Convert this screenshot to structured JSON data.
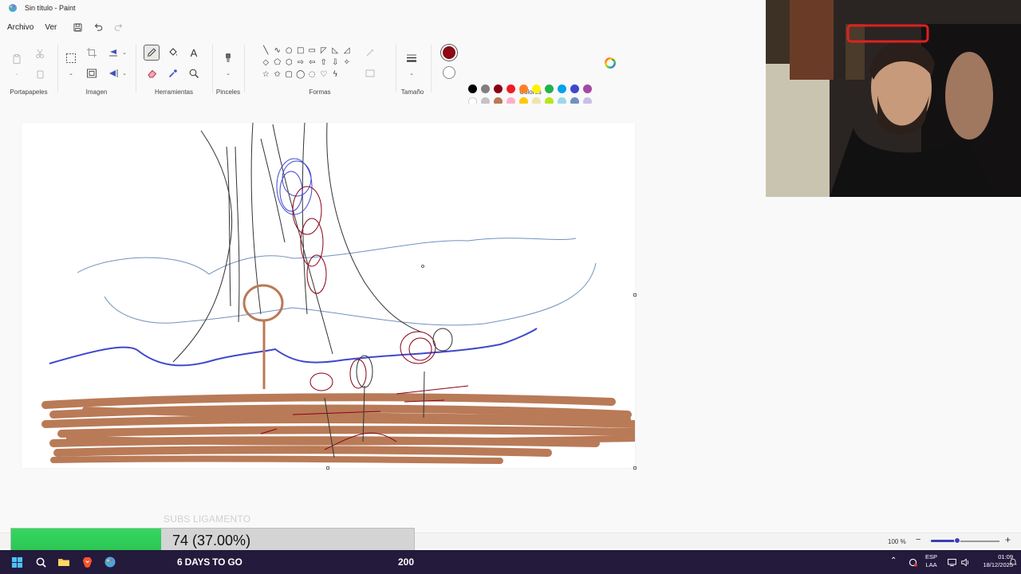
{
  "window": {
    "title": "Sin título - Paint"
  },
  "menu": {
    "file": "Archivo",
    "view": "Ver"
  },
  "ribbon": {
    "groups": {
      "clipboard": "Portapapeles",
      "image": "Imagen",
      "tools": "Herramientas",
      "brushes": "Pinceles",
      "shapes": "Formas",
      "size": "Tamaño",
      "colors": "Colores"
    },
    "text_tool": "A",
    "shape_glyphs": [
      "╲",
      "∿",
      "○",
      "□",
      "▭",
      "◸",
      "◺",
      "◿",
      "◇",
      "⬠",
      "⬡",
      "⇨",
      "⇦",
      "⇧",
      "⇩",
      "✧",
      "☆",
      "✩",
      "▢",
      "◯",
      "◌",
      "♡",
      "ϟ",
      ""
    ],
    "palette_row1": [
      "#000000",
      "#7f7f7f",
      "#880015",
      "#ed1c24",
      "#ff7f27",
      "#fff200",
      "#22b14c",
      "#00a2e8",
      "#3f48cc",
      "#a349a4"
    ],
    "palette_row2": [
      "#ffffff",
      "#c3c3c3",
      "#b97a57",
      "#ffaec9",
      "#ffc90e",
      "#efe4b0",
      "#b5e61d",
      "#99d9ea",
      "#7092be",
      "#c8bfe7"
    ],
    "primary_color": "#8b0a14",
    "secondary_color": "#ffffff"
  },
  "overlay": {
    "subs_label": "SUBS LIGAMENTO"
  },
  "status": {
    "zoom": "100 %",
    "zoom_level": 0.38
  },
  "goal": {
    "text": "74 (37.00%)",
    "progress": 0.37
  },
  "taskbar": {
    "countdown": "6 DAYS TO GO",
    "count": "200",
    "lang_line1": "ESP",
    "lang_line2": "LAA",
    "time": "01:09",
    "date": "18/12/2025"
  }
}
